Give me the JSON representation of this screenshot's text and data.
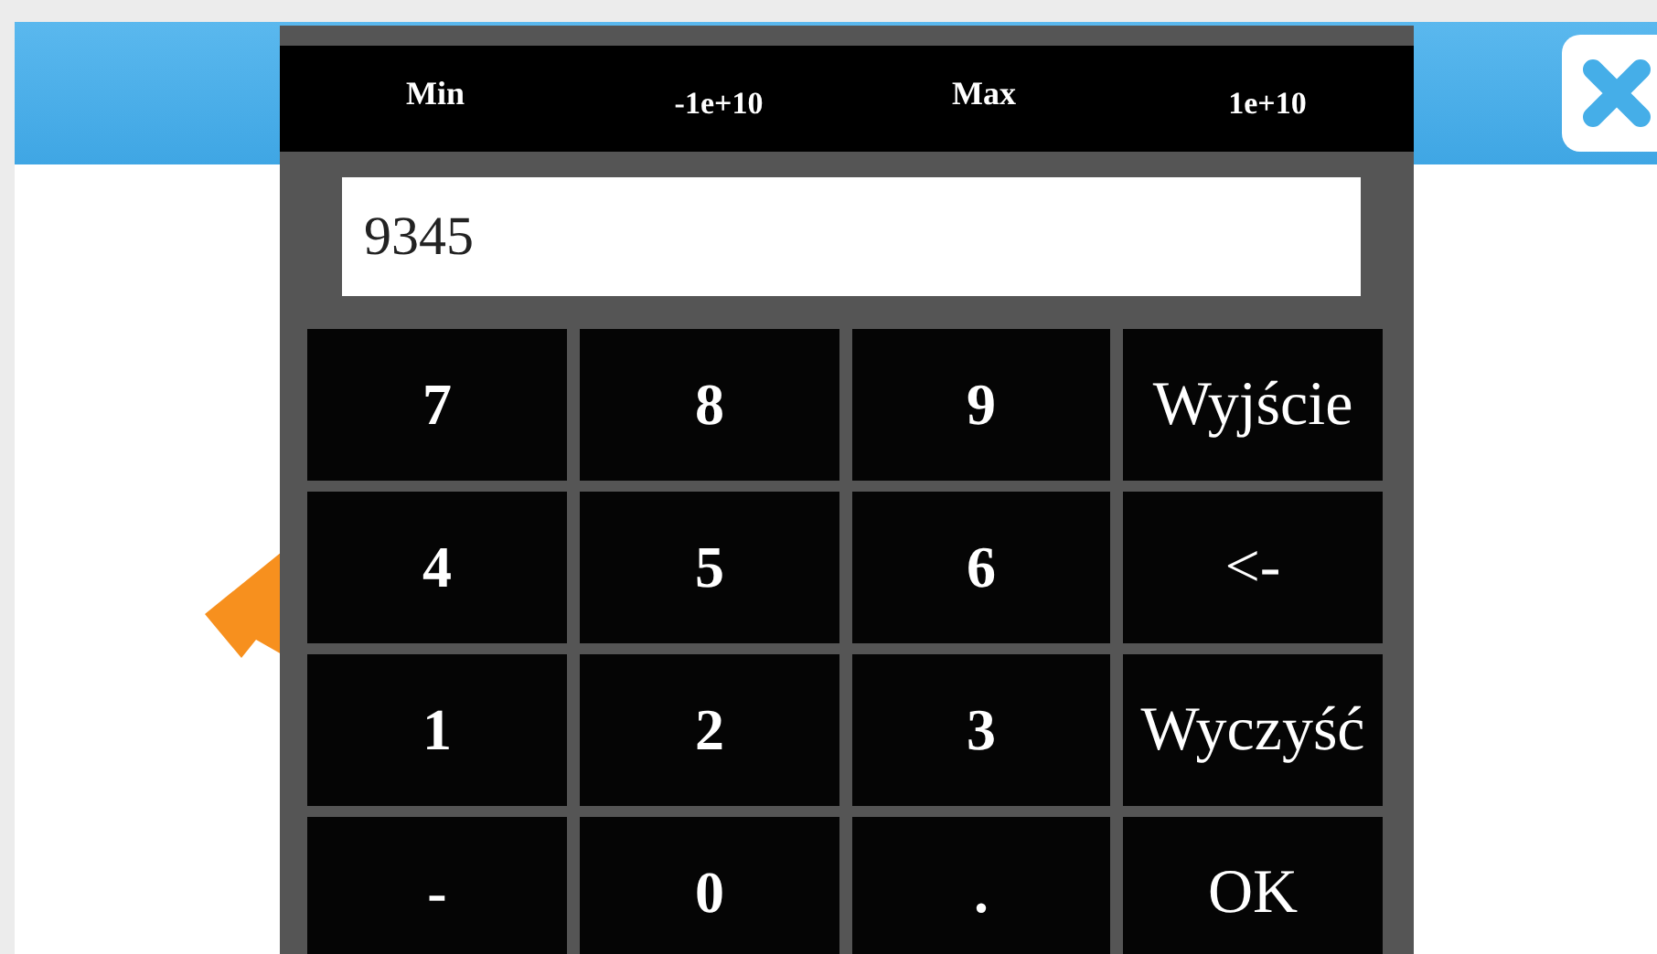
{
  "limits": [
    {
      "label": "Min",
      "value": "-1e+10"
    },
    {
      "label": "Max",
      "value": "1e+10"
    }
  ],
  "input": {
    "value": "9345"
  },
  "keys": [
    {
      "label": "7",
      "kind": "digit"
    },
    {
      "label": "8",
      "kind": "digit"
    },
    {
      "label": "9",
      "kind": "digit"
    },
    {
      "label": "Wyjście",
      "kind": "command"
    },
    {
      "label": "4",
      "kind": "digit"
    },
    {
      "label": "5",
      "kind": "digit"
    },
    {
      "label": "6",
      "kind": "digit"
    },
    {
      "label": "<-",
      "kind": "command"
    },
    {
      "label": "1",
      "kind": "digit"
    },
    {
      "label": "2",
      "kind": "digit"
    },
    {
      "label": "3",
      "kind": "digit"
    },
    {
      "label": "Wyczyść",
      "kind": "command"
    },
    {
      "label": "-",
      "kind": "digit"
    },
    {
      "label": "0",
      "kind": "digit"
    },
    {
      "label": ".",
      "kind": "digit"
    },
    {
      "label": "OK",
      "kind": "command"
    }
  ]
}
